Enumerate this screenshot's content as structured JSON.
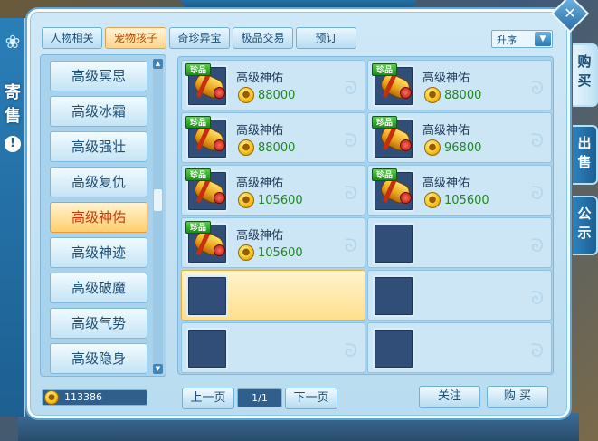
{
  "side_label": {
    "title": "寄售",
    "info": "!"
  },
  "close_icon": "✕",
  "vertical_tabs": [
    {
      "label": "购买",
      "active": true
    },
    {
      "label": "出售",
      "active": false
    },
    {
      "label": "公示",
      "active": false
    }
  ],
  "tabs": [
    {
      "label": "人物相关",
      "active": false
    },
    {
      "label": "宠物孩子",
      "active": true
    },
    {
      "label": "奇珍异宝",
      "active": false
    },
    {
      "label": "极品交易",
      "active": false
    },
    {
      "label": "预订",
      "active": false
    }
  ],
  "sort": {
    "selected": "升序"
  },
  "categories": [
    {
      "label": "高级冥思",
      "active": false
    },
    {
      "label": "高级冰霜",
      "active": false
    },
    {
      "label": "高级强壮",
      "active": false
    },
    {
      "label": "高级复仇",
      "active": false
    },
    {
      "label": "高级神佑",
      "active": true
    },
    {
      "label": "高级神迹",
      "active": false
    },
    {
      "label": "高级破魔",
      "active": false
    },
    {
      "label": "高级气势",
      "active": false
    },
    {
      "label": "高级隐身",
      "active": false
    }
  ],
  "goods": [
    {
      "name": "高级神佑",
      "price": "88000",
      "badge": "珍品"
    },
    {
      "name": "高级神佑",
      "price": "88000",
      "badge": "珍品"
    },
    {
      "name": "高级神佑",
      "price": "88000",
      "badge": "珍品"
    },
    {
      "name": "高级神佑",
      "price": "96800",
      "badge": "珍品"
    },
    {
      "name": "高级神佑",
      "price": "105600",
      "badge": "珍品"
    },
    {
      "name": "高级神佑",
      "price": "105600",
      "badge": "珍品"
    },
    {
      "name": "高级神佑",
      "price": "105600",
      "badge": "珍品"
    }
  ],
  "wallet": {
    "amount": "113386"
  },
  "pagination": {
    "prev": "上一页",
    "page": "1/1",
    "next": "下一页"
  },
  "actions": {
    "follow": "关注",
    "buy": "购 买"
  },
  "colors": {
    "panel_bg": "#cfe8f7",
    "accent": "#2d82bd",
    "active_tab": "#ffd48a",
    "price": "#1e8a1e"
  }
}
